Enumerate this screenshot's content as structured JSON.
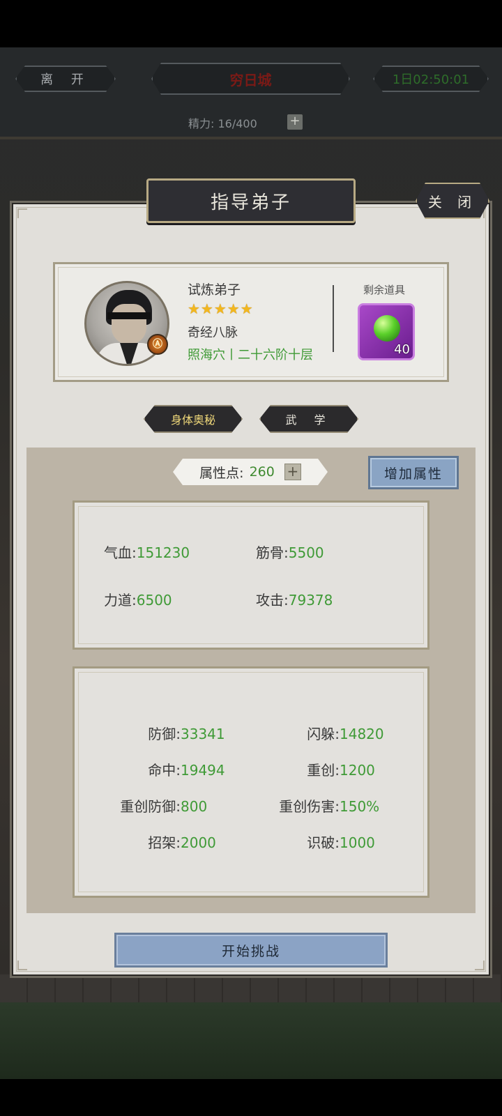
{
  "topbar": {
    "leave_label": "离 开",
    "city_title": "穷日城",
    "timer": "1日02:50:01",
    "stamina": "精力: 16/400",
    "stamina_plus": "+"
  },
  "dialog": {
    "title": "指导弟子",
    "close_label": "关 闭"
  },
  "character": {
    "name": "试炼弟子",
    "stars": "★★★★★",
    "skill": "奇经八脉",
    "stage": "照海穴丨二十六阶十层",
    "badge": "Ⓐ",
    "items_label": "剩余道具",
    "item_count": "40"
  },
  "tabs": [
    {
      "label": "身体奥秘"
    },
    {
      "label": "武 学"
    }
  ],
  "attributes": {
    "points_label": "属性点:",
    "points_value": "260",
    "points_plus": "+",
    "add_button": "增加属性",
    "base": [
      {
        "key": "气血:",
        "value": "151230"
      },
      {
        "key": "筋骨:",
        "value": "5500"
      },
      {
        "key": "力道:",
        "value": "6500"
      },
      {
        "key": "攻击:",
        "value": "79378"
      }
    ],
    "combat": [
      {
        "key": "防御:",
        "value": "33341"
      },
      {
        "key": "闪躲:",
        "value": "14820"
      },
      {
        "key": "命中:",
        "value": "19494"
      },
      {
        "key": "重创:",
        "value": "1200"
      },
      {
        "key": "重创防御:",
        "value": "800"
      },
      {
        "key": "重创伤害:",
        "value": "150%"
      },
      {
        "key": "招架:",
        "value": "2000"
      },
      {
        "key": "识破:",
        "value": "1000"
      }
    ]
  },
  "start_button": "开始挑战"
}
